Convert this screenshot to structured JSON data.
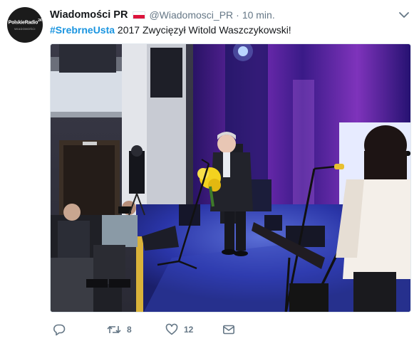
{
  "tweet": {
    "display_name": "Wiadomości PR",
    "handle": "@Wiadomosci_PR",
    "separator": "·",
    "time": "10 min.",
    "hashtag": "#SrebrneUsta",
    "body_text": " 2017 Zwycięzył Witold Waszczykowski!",
    "avatar_text": "PolskieRadio",
    "avatar_badge": "24",
    "avatar_sub": "WIADOMOŚCI"
  },
  "actions": {
    "reply_count": "",
    "retweet_count": "8",
    "like_count": "12"
  },
  "icons": {
    "menu": "chevron-down-icon",
    "reply": "reply-icon",
    "retweet": "retweet-icon",
    "like": "heart-icon",
    "dm": "envelope-icon"
  },
  "colors": {
    "link": "#1b95e0",
    "muted": "#657786",
    "flag_white": "#ffffff",
    "flag_red": "#dc143c"
  }
}
